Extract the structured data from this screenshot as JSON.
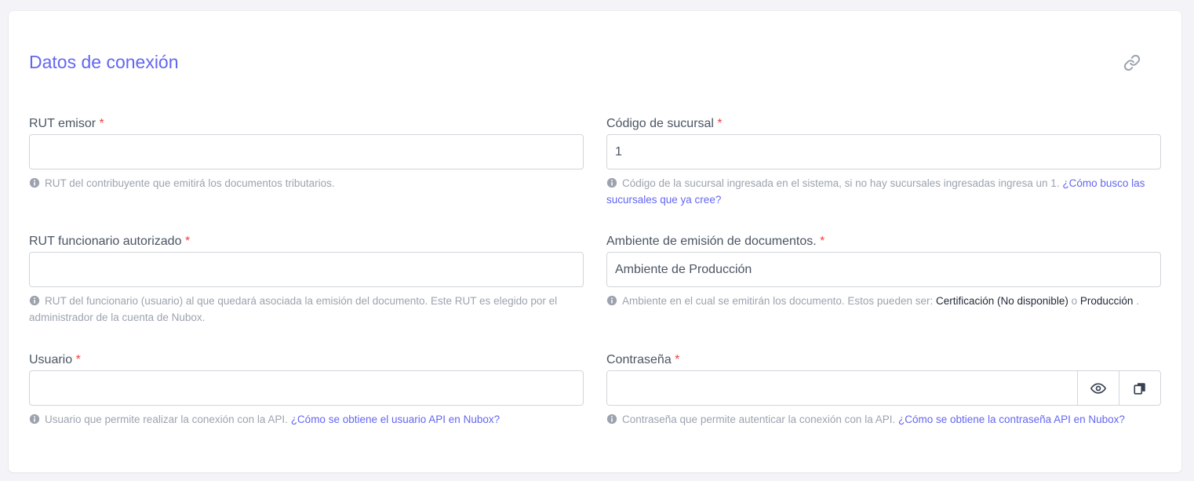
{
  "section": {
    "title": "Datos de conexión"
  },
  "icons": {
    "link": "link-icon",
    "info": "info-circle-icon",
    "eye": "eye-icon",
    "copy": "copy-icon"
  },
  "colors": {
    "accent": "#6366f1",
    "required": "#ef4444",
    "help": "#9ca3af"
  },
  "fields": {
    "rut_emisor": {
      "label": "RUT emisor",
      "required_mark": "*",
      "value": "",
      "help": "RUT del contribuyente que emitirá los documentos tributarios."
    },
    "codigo_sucursal": {
      "label": "Código de sucursal",
      "required_mark": "*",
      "value": "1",
      "help": "Código de la sucursal ingresada en el sistema, si no hay sucursales ingresadas ingresa un 1.",
      "link": "¿Cómo busco las sucursales que ya cree?"
    },
    "rut_funcionario": {
      "label": "RUT funcionario autorizado",
      "required_mark": "*",
      "value": "",
      "help": "RUT del funcionario (usuario) al que quedará asociada la emisión del documento. Este RUT es elegido por el administrador de la cuenta de Nubox."
    },
    "ambiente": {
      "label": "Ambiente de emisión de documentos.",
      "required_mark": "*",
      "value": "Ambiente de Producción",
      "help_prefix": "Ambiente en el cual se emitirán los documento. Estos pueden ser:",
      "option_1": "Certificación (No disponible)",
      "connector": "o",
      "option_2": "Producción",
      "help_suffix": "."
    },
    "usuario": {
      "label": "Usuario",
      "required_mark": "*",
      "value": "",
      "help": "Usuario que permite realizar la conexión con la API.",
      "link": "¿Cómo se obtiene el usuario API en Nubox?"
    },
    "contrasena": {
      "label": "Contraseña",
      "required_mark": "*",
      "value": "",
      "help": "Contraseña que permite autenticar la conexión con la API.",
      "link": "¿Cómo se obtiene la contraseña API en Nubox?"
    }
  }
}
